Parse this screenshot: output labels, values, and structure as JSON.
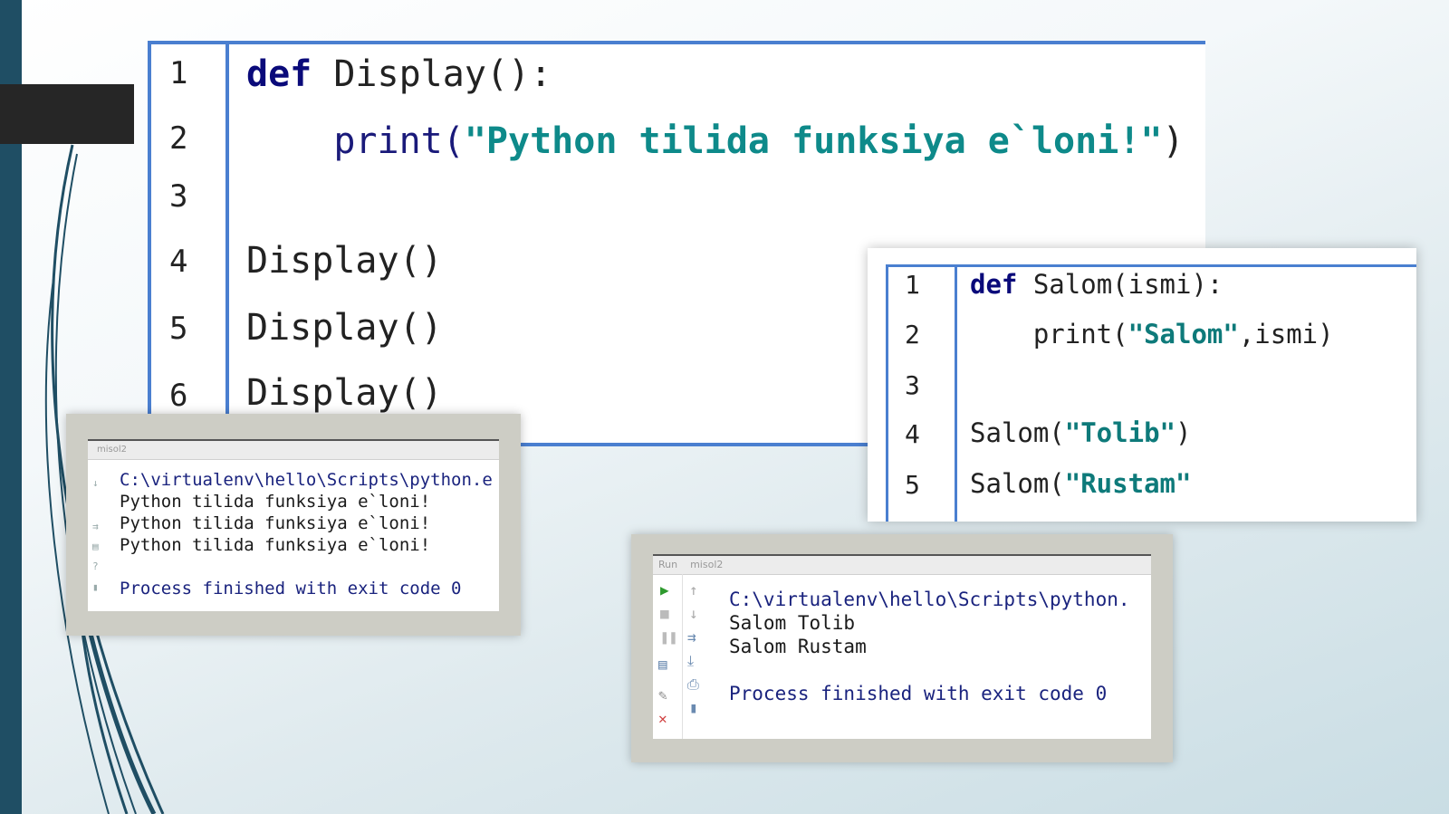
{
  "editor1": {
    "line_numbers": [
      "1",
      "2",
      "3",
      "4",
      "5",
      "6"
    ],
    "line1": {
      "kw": "def",
      "rest": " Display():"
    },
    "line2": {
      "indent": "    ",
      "fn": "print(",
      "str": "\"Python tilida funksiya e`loni!\"",
      "close": ")"
    },
    "line4": "Display()",
    "line5": "Display()",
    "line6": "Display()"
  },
  "console1": {
    "title": "misol2",
    "path": "C:\\virtualenv\\hello\\Scripts\\python.e",
    "outputs": [
      "Python tilida funksiya e`loni!",
      "Python tilida funksiya e`loni!",
      "Python tilida funksiya e`loni!"
    ],
    "done": "Process finished with exit code 0"
  },
  "editor2": {
    "line_numbers": [
      "1",
      "2",
      "3",
      "4",
      "5"
    ],
    "line1": {
      "kw": "def",
      "rest": " Salom(ismi):"
    },
    "line2": {
      "indent": "    ",
      "fn": "print(",
      "str": "\"Salom\"",
      "rest": ",ismi)"
    },
    "line4": {
      "fn": "Salom(",
      "str": "\"Tolib\"",
      "close": ")"
    },
    "line5": {
      "fn": "Salom(",
      "str": "\"Rustam\""
    }
  },
  "console2": {
    "run_label": "Run",
    "title": "misol2",
    "path": "C:\\virtualenv\\hello\\Scripts\\python.",
    "outputs": [
      "Salom Tolib",
      "Salom Rustam"
    ],
    "done": "Process finished with exit code 0"
  },
  "icons": {
    "run": "play-icon",
    "stop": "stop-icon",
    "pause": "pause-icon",
    "layout": "layout-icon",
    "pin": "pin-icon",
    "close": "close-icon",
    "up": "up-arrow-icon",
    "down": "down-arrow-icon",
    "wrap": "soft-wrap-icon",
    "scroll": "scroll-end-icon",
    "print": "print-icon",
    "trash": "trash-icon"
  },
  "colors": {
    "accent": "#4a7fd0",
    "sidebar": "#1f4e64",
    "keyword": "#0a0a7a",
    "string": "#0e8a8a"
  }
}
